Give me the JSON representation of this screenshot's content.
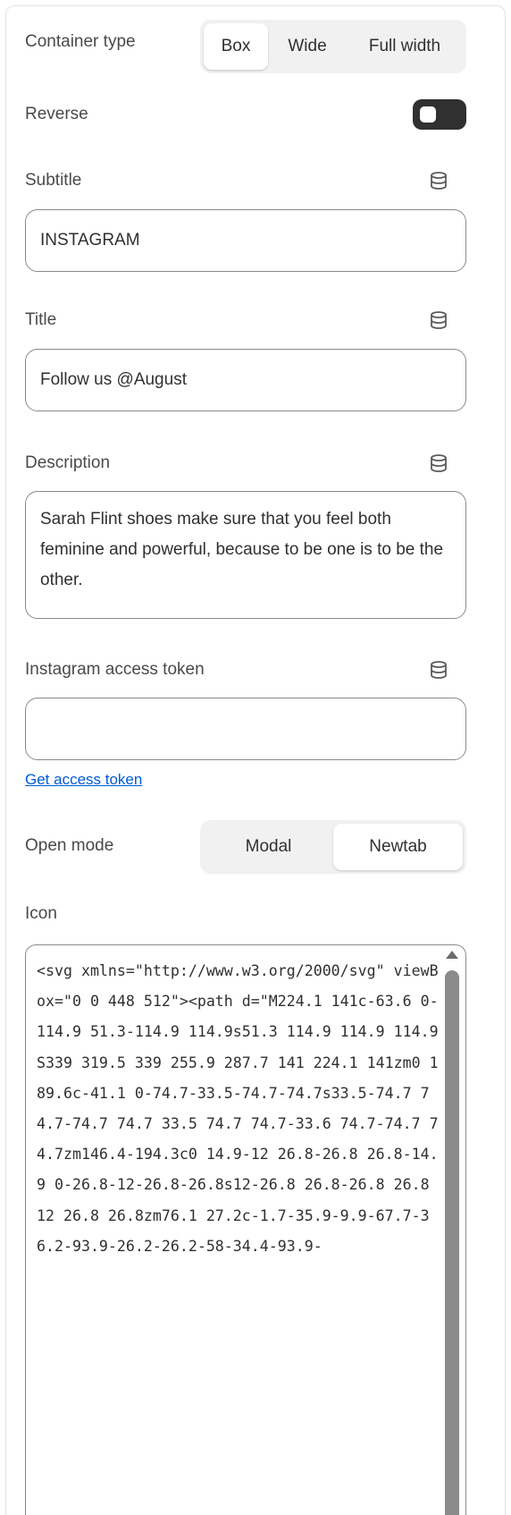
{
  "container_type": {
    "label": "Container type",
    "options": [
      "Box",
      "Wide",
      "Full width"
    ],
    "selected": "Box"
  },
  "reverse": {
    "label": "Reverse",
    "enabled": false
  },
  "subtitle": {
    "label": "Subtitle",
    "value": "INSTAGRAM"
  },
  "title": {
    "label": "Title",
    "value": "Follow us @August"
  },
  "description": {
    "label": "Description",
    "value": "Sarah Flint shoes make sure that you feel both feminine and powerful, because to be one is to be the other."
  },
  "access_token": {
    "label": "Instagram access token",
    "value": "",
    "link_label": "Get access token"
  },
  "open_mode": {
    "label": "Open mode",
    "options": [
      "Modal",
      "Newtab"
    ],
    "selected": "Newtab"
  },
  "icon": {
    "label": "Icon",
    "code": "<svg xmlns=\"http://www.w3.org/2000/svg\" viewBox=\"0 0 448 512\"><path d=\"M224.1 141c-63.6 0-114.9 51.3-114.9 114.9s51.3 114.9 114.9 114.9S339 319.5 339 255.9 287.7 141 224.1 141zm0 189.6c-41.1 0-74.7-33.5-74.7-74.7s33.5-74.7 74.7-74.7 74.7 33.5 74.7 74.7-33.6 74.7-74.7 74.7zm146.4-194.3c0 14.9-12 26.8-26.8 26.8-14.9 0-26.8-12-26.8-26.8s12-26.8 26.8-26.8 26.8 12 26.8 26.8zm76.1 27.2c-1.7-35.9-9.9-67.7-36.2-93.9-26.2-26.2-58-34.4-93.9-"
  },
  "icons": {
    "database": "database-icon",
    "scroll_up": "scroll-up-arrow"
  },
  "colors": {
    "accent_link": "#005bd3",
    "toggle_bg": "#303030",
    "border": "#8a8a8a"
  }
}
